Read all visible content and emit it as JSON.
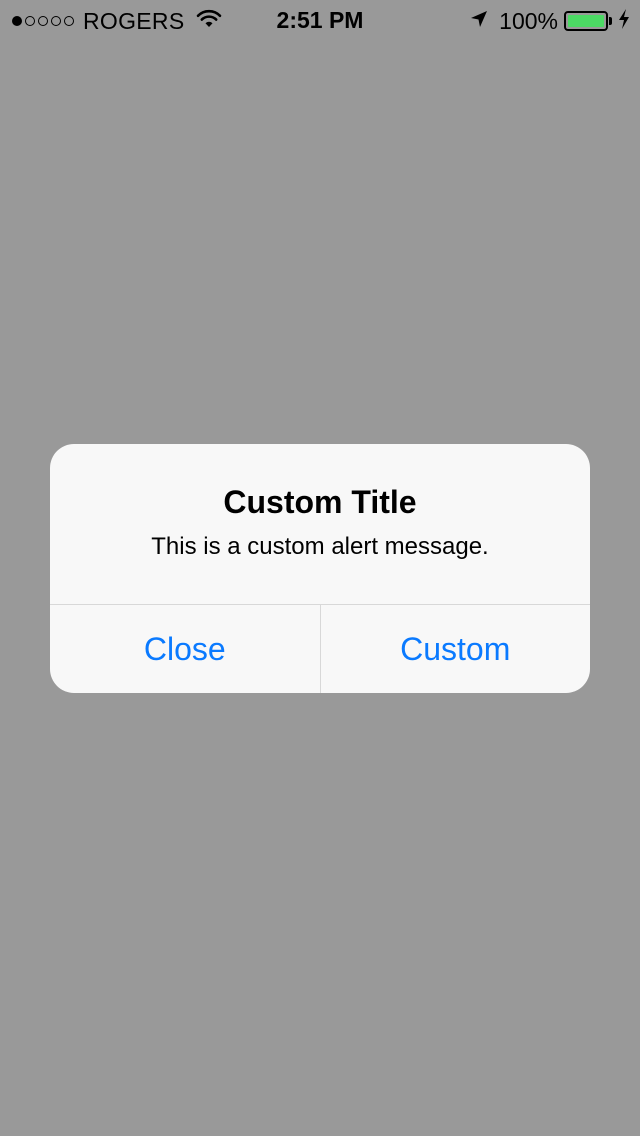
{
  "status_bar": {
    "signal_bars_filled": 1,
    "signal_bars_total": 5,
    "carrier": "ROGERS",
    "time": "2:51 PM",
    "battery_percent": "100%",
    "battery_level": 1.0,
    "icons": {
      "wifi": "wifi-icon",
      "location": "location-arrow-icon",
      "battery": "battery-icon",
      "charging": "charging-bolt-icon"
    }
  },
  "alert": {
    "title": "Custom Title",
    "message": "This is a custom alert message.",
    "buttons": [
      {
        "label": "Close"
      },
      {
        "label": "Custom"
      }
    ]
  },
  "colors": {
    "background_dim": "#999999",
    "alert_background": "#f8f8f8",
    "button_text": "#0a7aff",
    "battery_fill": "#4cd964"
  }
}
